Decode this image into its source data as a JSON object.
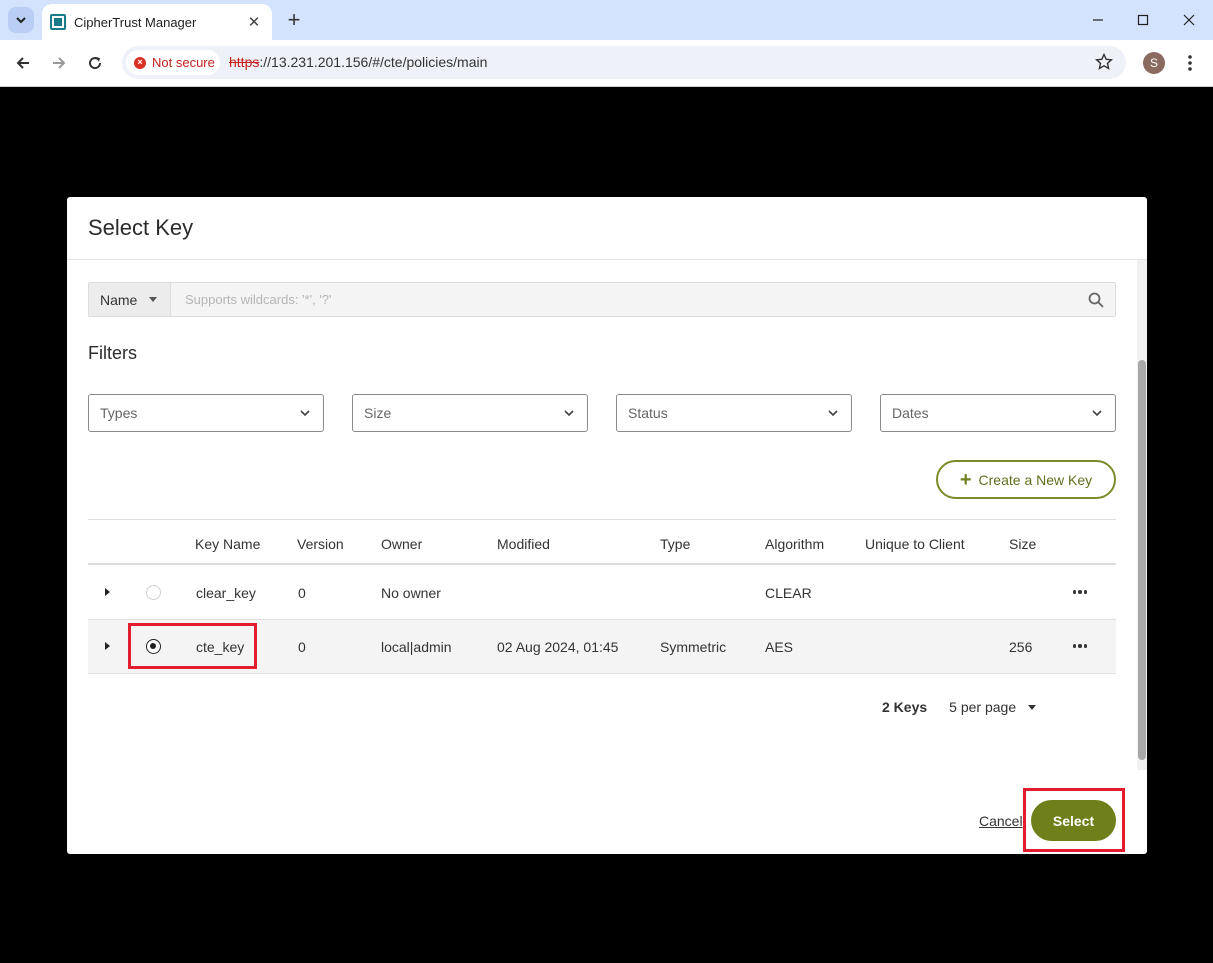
{
  "browser": {
    "tab_title": "CipherTrust Manager",
    "security_label": "Not secure",
    "url_scheme": "https",
    "url_rest": "://13.231.201.156/#/cte/policies/main",
    "profile_initial": "S"
  },
  "dialog": {
    "title": "Select Key",
    "search": {
      "field_label": "Name",
      "placeholder": "Supports wildcards: '*', '?'"
    },
    "filters_title": "Filters",
    "filters": [
      "Types",
      "Size",
      "Status",
      "Dates"
    ],
    "create_button": "Create a New Key",
    "columns": [
      "Key Name",
      "Version",
      "Owner",
      "Modified",
      "Type",
      "Algorithm",
      "Unique to Client",
      "Size"
    ],
    "rows": [
      {
        "key_name": "clear_key",
        "version": "0",
        "owner": "No owner",
        "modified": "",
        "type": "",
        "algorithm": "CLEAR",
        "unique": "",
        "size": "",
        "selected": false
      },
      {
        "key_name": "cte_key",
        "version": "0",
        "owner": "local|admin",
        "modified": "02 Aug 2024, 01:45",
        "type": "Symmetric",
        "algorithm": "AES",
        "unique": "",
        "size": "256",
        "selected": true
      }
    ],
    "pagination": {
      "count": "2 Keys",
      "per_page": "5 per page"
    },
    "cancel_label": "Cancel",
    "select_label": "Select"
  },
  "colors": {
    "accent": "#6f7f1a",
    "highlight": "#e31d2e"
  }
}
